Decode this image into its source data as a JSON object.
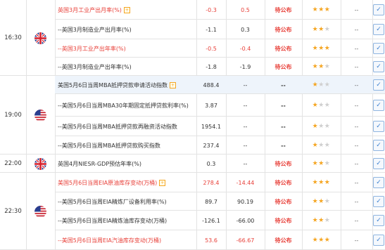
{
  "colors": {
    "red": "#e8413a",
    "text": "#333333",
    "star": "#f5a623",
    "checkbox_border": "#8fb5e0"
  },
  "groups": [
    {
      "time": "16:30",
      "flag": "uk-flag-icon"
    },
    {
      "time": "19:00",
      "flag": "us-flag-icon"
    },
    {
      "time": "22:00",
      "flag": "uk-flag-icon"
    },
    {
      "time": "22:30",
      "flag": "us-flag-icon"
    }
  ],
  "rows": [
    {
      "name": "英国3月工业产出月率(%)",
      "tag": "+",
      "actual": "-0.3",
      "previous": "0.5",
      "status": "待公布",
      "stars": 3,
      "effect": "--",
      "red": true
    },
    {
      "name": "--英国3月制造业产出月率(%)",
      "tag": "",
      "actual": "-1.1",
      "previous": "0.3",
      "status": "待公布",
      "stars": 2,
      "effect": "--",
      "red": false
    },
    {
      "name": "--英国3月工业产出年率(%)",
      "tag": "",
      "actual": "-0.5",
      "previous": "-0.4",
      "status": "待公布",
      "stars": 3,
      "effect": "--",
      "red": true
    },
    {
      "name": "--英国3月制造业产出年率(%)",
      "tag": "",
      "actual": "-1.8",
      "previous": "-1.9",
      "status": "待公布",
      "stars": 2,
      "effect": "--",
      "red": false
    },
    {
      "name": "美国5月6日当周MBA抵押贷款申请活动指数",
      "tag": "+",
      "actual": "488.4",
      "previous": "--",
      "status": "--",
      "stars": 1,
      "effect": "--",
      "red": false
    },
    {
      "name": "--美国5月6日当周MBA30年期固定抵押贷款利率(%)",
      "tag": "",
      "actual": "3.87",
      "previous": "--",
      "status": "--",
      "stars": 1,
      "effect": "--",
      "red": false
    },
    {
      "name": "--美国5月6日当周MBA抵押贷款再融资活动指数",
      "tag": "",
      "actual": "1954.1",
      "previous": "--",
      "status": "--",
      "stars": 1,
      "effect": "--",
      "red": false
    },
    {
      "name": "--美国5月6日当周MBA抵押贷款购买指数",
      "tag": "",
      "actual": "237.4",
      "previous": "--",
      "status": "--",
      "stars": 1,
      "effect": "--",
      "red": false
    },
    {
      "name": "英国4月NIESR-GDP预估年率(%)",
      "tag": "",
      "actual": "0.3",
      "previous": "--",
      "status": "待公布",
      "stars": 2,
      "effect": "--",
      "red": false
    },
    {
      "name": "美国5月6日当周EIA原油库存变动(万桶)",
      "tag": "+",
      "actual": "278.4",
      "previous": "-14.44",
      "status": "待公布",
      "stars": 3,
      "effect": "--",
      "red": true
    },
    {
      "name": "--美国5月6日当周EIA精炼厂设备利用率(%)",
      "tag": "",
      "actual": "89.7",
      "previous": "90.19",
      "status": "待公布",
      "stars": 2,
      "effect": "--",
      "red": false
    },
    {
      "name": "--美国5月6日当周EIA精炼油库存变动(万桶)",
      "tag": "",
      "actual": "-126.1",
      "previous": "-66.00",
      "status": "待公布",
      "stars": 2,
      "effect": "--",
      "red": false
    },
    {
      "name": "--美国5月6日当周EIA汽油库存变动(万桶)",
      "tag": "",
      "actual": "53.6",
      "previous": "-66.67",
      "status": "待公布",
      "stars": 3,
      "effect": "--",
      "red": true
    }
  ]
}
